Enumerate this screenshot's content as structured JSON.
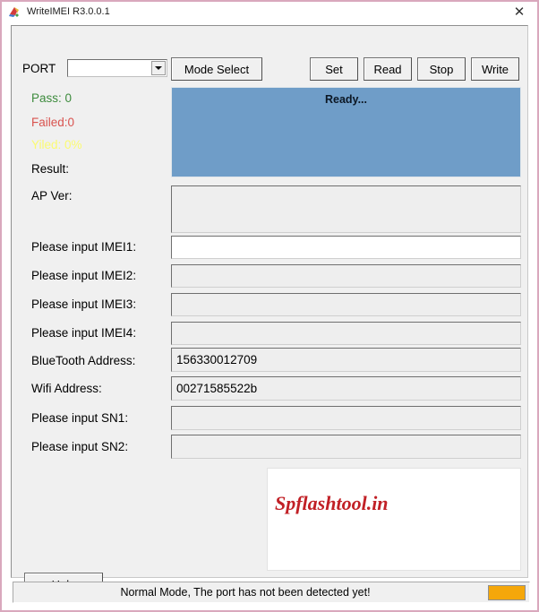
{
  "window": {
    "title": "WriteIMEI R3.0.0.1",
    "icon": "app-icon",
    "close_label": "✕",
    "border_color": "#d9a8bd"
  },
  "toolbar": {
    "port_label": "PORT",
    "port_value": "",
    "port_placeholder": "",
    "mode_select_label": "Mode Select",
    "set_label": "Set",
    "read_label": "Read",
    "stop_label": "Stop",
    "write_label": "Write"
  },
  "status": {
    "pass_label": "Pass:  0",
    "pass_color": "#3d8b3d",
    "failed_label": "Failed:0",
    "failed_color": "#d9534f",
    "yield_label": "Yiled: 0%",
    "yield_color": "#fbfb72",
    "result_label": "Result:",
    "ap_ver_label": "AP Ver:"
  },
  "ready_panel": {
    "text": "Ready...",
    "background": "#6f9dc8"
  },
  "fields": [
    {
      "label": "AP Ver:",
      "value": "",
      "enabled": false,
      "name": "ap-ver"
    },
    {
      "label": "Please input IMEI1:",
      "value": "",
      "enabled": true,
      "name": "imei1"
    },
    {
      "label": "Please input IMEI2:",
      "value": "",
      "enabled": false,
      "name": "imei2"
    },
    {
      "label": "Please input IMEI3:",
      "value": "",
      "enabled": false,
      "name": "imei3"
    },
    {
      "label": "Please input IMEI4:",
      "value": "",
      "enabled": false,
      "name": "imei4"
    },
    {
      "label": "BlueTooth Address:",
      "value": "156330012709",
      "enabled": false,
      "name": "bluetooth-address"
    },
    {
      "label": "Wifi Address:",
      "value": "00271585522b",
      "enabled": false,
      "name": "wifi-address"
    },
    {
      "label": "Please input SN1:",
      "value": "",
      "enabled": false,
      "name": "sn1"
    },
    {
      "label": "Please input SN2:",
      "value": "",
      "enabled": false,
      "name": "sn2"
    }
  ],
  "log_panel": {
    "watermark": "Spflashtool.in",
    "watermark_color": "#c12026",
    "content": ""
  },
  "footer": {
    "help_label": "Help",
    "status_text": "Normal Mode, The port has not been detected yet!",
    "indicator_color": "#f5a70a"
  }
}
